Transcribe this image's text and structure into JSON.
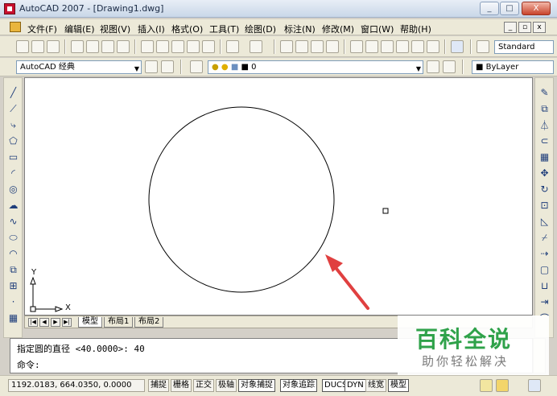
{
  "window": {
    "title": "AutoCAD 2007 - [Drawing1.dwg]",
    "min": "_",
    "max": "□",
    "close": "X"
  },
  "menu": {
    "items": [
      "文件(F)",
      "编辑(E)",
      "视图(V)",
      "插入(I)",
      "格式(O)",
      "工具(T)",
      "绘图(D)",
      "标注(N)",
      "修改(M)",
      "窗口(W)",
      "帮助(H)"
    ],
    "mdi_min": "_",
    "mdi_restore": "▫",
    "mdi_close": "x"
  },
  "toolbar": {
    "text_style": "Standard"
  },
  "props": {
    "workspace": "AutoCAD 经典",
    "layer": "0",
    "color": "ByLayer"
  },
  "drawing": {
    "ucs_x": "X",
    "ucs_y": "Y"
  },
  "tabs": {
    "model": "模型",
    "layout1": "布局1",
    "layout2": "布局2"
  },
  "command": {
    "line1": "指定圆的直径 <40.0000>: 40",
    "line2": "命令:"
  },
  "status": {
    "coords": "1192.0183, 664.0350, 0.0000",
    "buttons": [
      "捕捉",
      "栅格",
      "正交",
      "极轴",
      "对象捕捉",
      "对象追踪",
      "DUCS",
      "DYN",
      "线宽",
      "模型"
    ]
  },
  "watermark": {
    "title": "百科全说",
    "subtitle": "助你轻松解决"
  },
  "colors": {
    "annotation_arrow": "#e04040",
    "watermark_green": "#2fa24a"
  }
}
